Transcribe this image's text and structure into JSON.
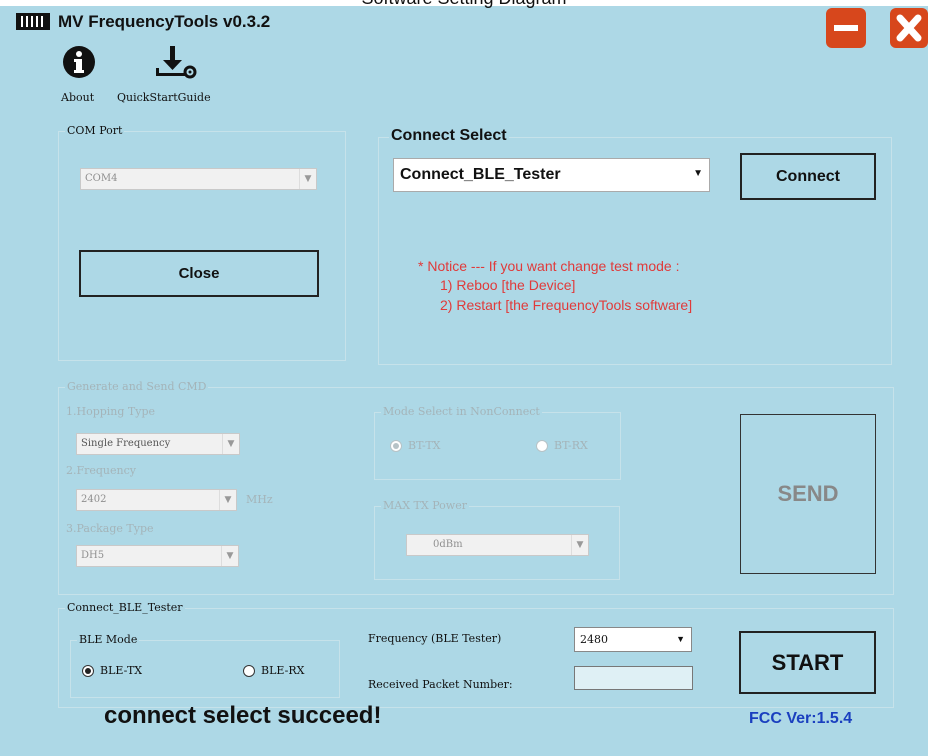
{
  "caption": "Software Setting Diagram",
  "window": {
    "title": "MV FrequencyTools v0.3.2"
  },
  "toolbar": {
    "about_label": "About",
    "quickstart_label": "QuickStartGuide"
  },
  "com_port": {
    "group_label": "COM Port",
    "selected": "COM4",
    "close_label": "Close"
  },
  "connect_select": {
    "group_label": "Connect Select",
    "selected": "Connect_BLE_Tester",
    "connect_label": "Connect",
    "notice": [
      "* Notice --- If you want change test mode :",
      "1) Reboo [the Device]",
      "2) Restart [the FrequencyTools software]"
    ]
  },
  "generate": {
    "group_label": "Generate and Send CMD",
    "hopping_label": "1.Hopping Type",
    "hopping_value": "Single Frequency",
    "frequency_label": "2.Frequency",
    "frequency_value": "2402",
    "frequency_unit": "MHz",
    "package_label": "3.Package Type",
    "package_value": "DH5",
    "mode_group_label": "Mode Select in NonConnect",
    "mode_tx": "BT-TX",
    "mode_rx": "BT-RX",
    "power_group_label": "MAX TX Power",
    "power_value": "0dBm",
    "send_label": "SEND"
  },
  "ble_tester": {
    "group_label": "Connect_BLE_Tester",
    "mode_group_label": "BLE Mode",
    "mode_tx": "BLE-TX",
    "mode_rx": "BLE-RX",
    "frequency_label": "Frequency (BLE Tester)",
    "frequency_value": "2480",
    "received_label": "Received Packet Number:",
    "received_value": "",
    "start_label": "START"
  },
  "status": {
    "message": "connect select succeed!",
    "fcc_version": "FCC Ver:1.5.4"
  },
  "colors": {
    "background": "#add8e6",
    "notice": "#e03a3a",
    "fcc": "#1a3fbf",
    "title_button": "#d7471c"
  }
}
